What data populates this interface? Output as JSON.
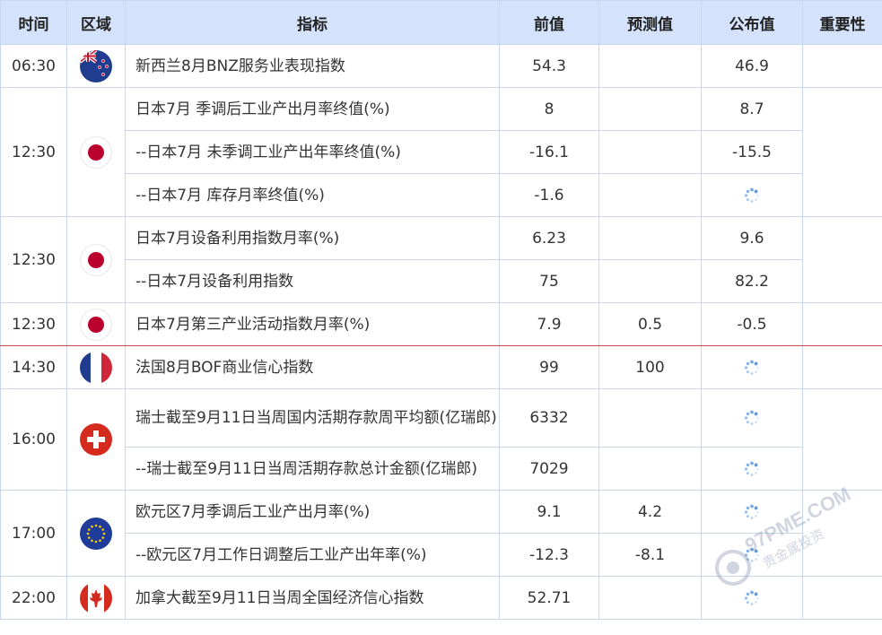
{
  "header": {
    "time": "时间",
    "region": "区域",
    "indicator": "指标",
    "previous": "前值",
    "forecast": "预测值",
    "actual": "公布值",
    "importance": "重要性"
  },
  "rows": [
    {
      "time": "06:30",
      "flag": "new-zealand",
      "indicator": "新西兰8月BNZ服务业表现指数",
      "previous": "54.3",
      "forecast": "",
      "actual": "46.9"
    },
    {
      "time": "12:30",
      "flag": "japan",
      "indicator": "日本7月 季调后工业产出月率终值(%)",
      "previous": "8",
      "forecast": "",
      "actual": "8.7"
    },
    {
      "indicator": "--日本7月 未季调工业产出年率终值(%)",
      "previous": "-16.1",
      "forecast": "",
      "actual": "-15.5"
    },
    {
      "indicator": "--日本7月 库存月率终值(%)",
      "previous": "-1.6",
      "forecast": "",
      "actual": ""
    },
    {
      "time": "12:30",
      "flag": "japan",
      "indicator": "日本7月设备利用指数月率(%)",
      "previous": "6.23",
      "forecast": "",
      "actual": "9.6"
    },
    {
      "indicator": "--日本7月设备利用指数",
      "previous": "75",
      "forecast": "",
      "actual": "82.2"
    },
    {
      "time": "12:30",
      "flag": "japan",
      "indicator": "日本7月第三产业活动指数月率(%)",
      "previous": "7.9",
      "forecast": "0.5",
      "actual": "-0.5"
    },
    {
      "time": "14:30",
      "flag": "france",
      "indicator": "法国8月BOF商业信心指数",
      "previous": "99",
      "forecast": "100",
      "actual": ""
    },
    {
      "time": "16:00",
      "flag": "switzerland",
      "indicator": "瑞士截至9月11日当周国内活期存款周平均额(亿瑞郎)",
      "previous": "6332",
      "forecast": "",
      "actual": ""
    },
    {
      "indicator": "--瑞士截至9月11日当周活期存款总计金额(亿瑞郎)",
      "previous": "7029",
      "forecast": "",
      "actual": ""
    },
    {
      "time": "17:00",
      "flag": "eurozone",
      "indicator": "欧元区7月季调后工业产出月率(%)",
      "previous": "9.1",
      "forecast": "4.2",
      "actual": ""
    },
    {
      "indicator": "--欧元区7月工作日调整后工业产出年率(%)",
      "previous": "-12.3",
      "forecast": "-8.1",
      "actual": ""
    },
    {
      "time": "22:00",
      "flag": "canada",
      "indicator": "加拿大截至9月11日当周全国经济信心指数",
      "previous": "52.71",
      "forecast": "",
      "actual": ""
    }
  ],
  "watermark": {
    "text": "97PME.COM",
    "sub": "贵金属投资"
  }
}
